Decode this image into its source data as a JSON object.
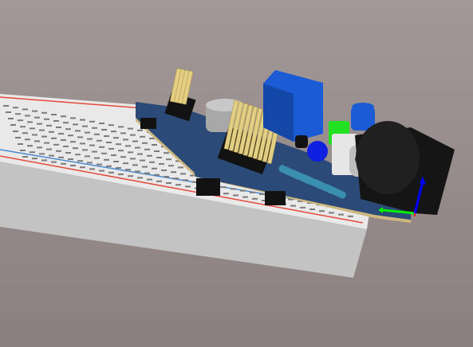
{
  "viewport": {
    "kind": "3d-cad-view",
    "background_top": "#a39898",
    "background_bottom": "#8b7f7f"
  },
  "breadboard": {
    "color": "#e9e9e9",
    "side_color": "#c3c3c3",
    "hole_color": "#7a7a7a",
    "rail_red": "#e34a3a",
    "rail_blue": "#4a8ad0"
  },
  "pcb": {
    "color": "#2b4a78",
    "silkscreen": "#c8b88a",
    "edge_color": "#cdb77e"
  },
  "components": [
    {
      "name": "blue-terminal-block",
      "color": "#1c5bd6"
    },
    {
      "name": "black-dc-jack",
      "color": "#151515"
    },
    {
      "name": "silver-electrolytic-capacitor",
      "color": "#a8a8a8"
    },
    {
      "name": "gold-pin-headers",
      "color": "#e3cf83"
    },
    {
      "name": "black-header-housings",
      "color": "#121212"
    },
    {
      "name": "resistors",
      "color": "#3a8fb0"
    },
    {
      "name": "blue-led",
      "color": "#1020e0"
    },
    {
      "name": "white-switch",
      "color": "#e6e6e6"
    },
    {
      "name": "green-component",
      "color": "#22e022"
    }
  ],
  "axes": {
    "x_color": "#00ee00",
    "y_color": "#0000ff",
    "z_color": "#ff2020"
  }
}
